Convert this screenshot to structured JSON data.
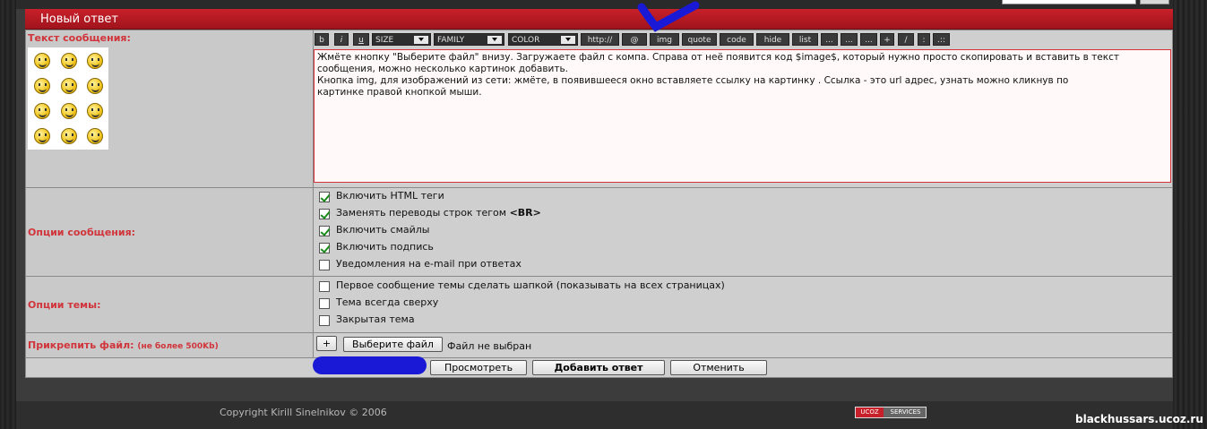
{
  "header": {
    "title": "Новый ответ"
  },
  "labels": {
    "message_text": "Текст сообщения:",
    "message_options": "Опции сообщения:",
    "topic_options": "Опции темы:",
    "attach_file": "Прикрепить файл:",
    "attach_note": "(не более 500Kb)"
  },
  "toolbar": {
    "bold": "b",
    "italic": "i",
    "underline": "u",
    "size": "SIZE",
    "family": "FAMILY",
    "color": "COLOR",
    "http": "http://",
    "email": "@",
    "img": "img",
    "quote": "quote",
    "code": "code",
    "hide": "hide",
    "list": "list",
    "extra1": "...",
    "extra2": "...",
    "extra3": "...",
    "plus": "+",
    "slash": "/",
    "colon": ":",
    "dots": ".::"
  },
  "message": {
    "text": "Жмёте кнопку \"Выберите файл\" внизу. Загружаете файл с компа. Справа от неё появится код $image$, который нужно просто скопировать и вставить в текст\nсообщения, можно несколько картинок добавить.\nКнопка img, для изображений из сети: жмёте, в появившееся окно вставляете ссылку на картинку . Ссылка - это url адрес, узнать можно кликнув по\nкартинке правой кнопкой мыши."
  },
  "message_options": [
    {
      "label": "Включить HTML теги",
      "checked": true
    },
    {
      "label": "Заменять переводы строк тегом",
      "suffix": "<BR>",
      "checked": true
    },
    {
      "label": "Включить смайлы",
      "checked": true
    },
    {
      "label": "Включить подпись",
      "checked": true
    },
    {
      "label": "Уведомления на e-mail при ответах",
      "checked": false
    }
  ],
  "topic_options": [
    {
      "label": "Первое сообщение темы сделать шапкой (показывать на всех страницах)",
      "checked": false
    },
    {
      "label": "Тема всегда сверху",
      "checked": false
    },
    {
      "label": "Закрытая тема",
      "checked": false
    }
  ],
  "attach": {
    "add_label": "+",
    "choose_label": "Выберите файл",
    "status": "Файл не выбран"
  },
  "actions": {
    "preview": "Просмотреть",
    "submit": "Добавить ответ",
    "cancel": "Отменить"
  },
  "footer": {
    "copyright": "Copyright Kirill Sinelnikov © 2006",
    "ucoz_left": "UCOZ",
    "ucoz_right": "SERVICES"
  },
  "site": "blackhussars.ucoz.ru",
  "colors": {
    "accent": "#c8202a",
    "label": "#d1343a",
    "annotation": "#1a1ad6"
  }
}
